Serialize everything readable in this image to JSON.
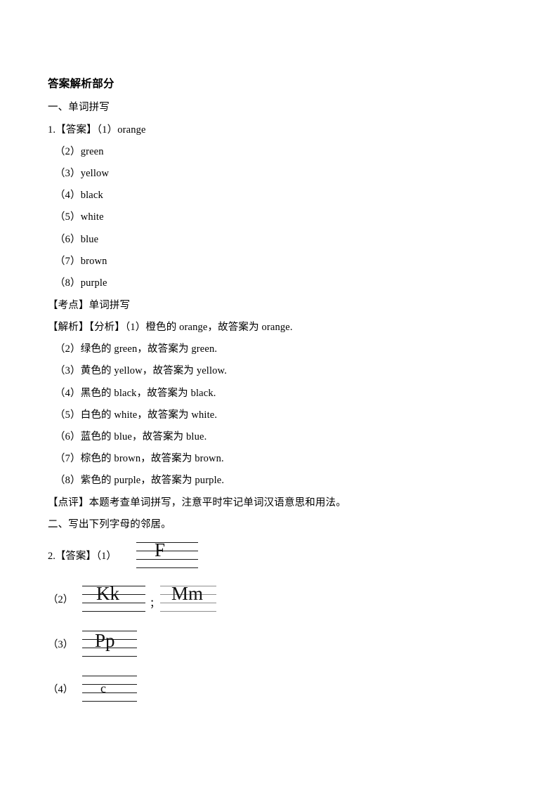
{
  "document": {
    "title": "答案解析部分",
    "section_one_heading": "一、单词拼写",
    "section_two_heading": "二、写出下列字母的邻居。"
  },
  "question_1": {
    "answer_prefix": "1.【答案】（1）orange",
    "answers": [
      "（2）green",
      "（3）yellow",
      "（4）black",
      "（5）white",
      "（6）blue",
      "（7）brown",
      "（8）purple"
    ],
    "kaodian": "【考点】单词拼写",
    "jiexi_first": "【解析】【分析】（1）橙色的 orange，故答案为 orange.",
    "jiexi_rest": [
      "（2）绿色的 green，故答案为 green.",
      "（3）黄色的 yellow，故答案为 yellow.",
      "（4）黑色的 black，故答案为 black.",
      "（5）白色的 white，故答案为 white.",
      "（6）蓝色的 blue，故答案为 blue.",
      "（7）棕色的 brown，故答案为 brown.",
      "（8）紫色的 purple，故答案为 purple."
    ],
    "dianping": "【点评】本题考查单词拼写，注意平时牢记单词汉语意思和用法。"
  },
  "question_2": {
    "label_1": "2.【答案】（1）",
    "label_2": "（2）",
    "label_3": "（3）",
    "label_4": "（4）",
    "separator": "；",
    "letters": {
      "item1": "F",
      "item2_a": "Kk",
      "item2_b": "Mm",
      "item3": "Pp",
      "item4": "c"
    }
  },
  "colors": {
    "text": "#000000",
    "stave_line": "#1a1a1a",
    "stave_line_light": "#8e8e8e",
    "background": "#ffffff"
  }
}
